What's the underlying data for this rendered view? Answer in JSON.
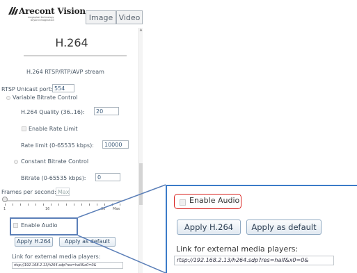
{
  "brand": {
    "name": "Arecont Vision",
    "tagline_line1": "megapixel technology",
    "tagline_line2": "beyond imagination"
  },
  "tabs": [
    {
      "label": "Image"
    },
    {
      "label": "Video"
    }
  ],
  "panel": {
    "title": "H.264",
    "stream_label": "H.264 RTSP/RTP/AVP stream",
    "rtsp_port_label": "RTSP Unicast port:",
    "rtsp_port_value": "554",
    "vbr_label": "Variable Bitrate Control",
    "quality_label": "H.264 Quality (36..16):",
    "quality_value": "20",
    "rate_limit_enable_label": "Enable Rate Limit",
    "rate_limit_label": "Rate limit (0-65535 kbps):",
    "rate_limit_value": "10000",
    "cbr_label": "Constant Bitrate Control",
    "bitrate_label": "Bitrate (0-65535 kbps):",
    "bitrate_value": "0",
    "fps_label": "Frames per second:",
    "fps_value": "Max",
    "slider_ticks": {
      "min": "1",
      "mid": "16",
      "high": "30",
      "max": "Max"
    },
    "enable_audio_label": "Enable Audio",
    "apply_label": "Apply H.264",
    "apply_default_label": "Apply as default",
    "link_label": "Link for external media players:",
    "link_url": "rtsp://192.168.2.13/h264.sdp?res=half&x0=0&"
  },
  "zoom": {
    "enable_audio_label": "Enable Audio",
    "apply_label": "Apply H.264",
    "apply_default_label": "Apply as default",
    "link_label": "Link for external media players:",
    "link_url": "rtsp://192.168.2.13/h264.sdp?res=half&x0=0&"
  },
  "colors": {
    "highlight_blue": "#3b7bc8",
    "callout_red": "#d9201c"
  }
}
